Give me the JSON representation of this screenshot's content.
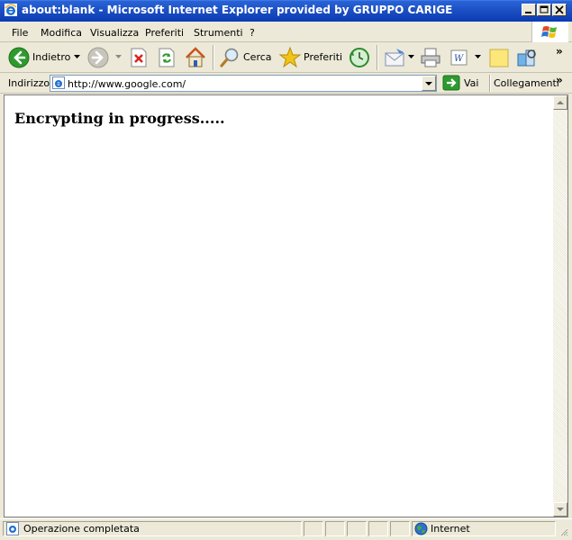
{
  "window": {
    "title": "about:blank - Microsoft Internet Explorer provided by GRUPPO CARIGE",
    "icon": "ie-icon",
    "controls": [
      "minimize-icon",
      "maximize-icon",
      "close-icon"
    ]
  },
  "menu": {
    "items": [
      "File",
      "Modifica",
      "Visualizza",
      "Preferiti",
      "Strumenti",
      "?"
    ]
  },
  "toolbar": {
    "back_label": "Indietro",
    "search_label": "Cerca",
    "favorites_label": "Preferiti",
    "overflow": "»"
  },
  "address": {
    "label": "Indirizzo",
    "value": "http://www.google.com/",
    "go_label": "Vai",
    "links_label": "Collegamenti",
    "overflow": "»"
  },
  "content": {
    "heading": "Encrypting in progress....."
  },
  "status": {
    "text": "Operazione completata",
    "zone": "Internet"
  },
  "colors": {
    "titlebar": "#0a3bb3",
    "chrome": "#ece9d8",
    "back_green": "#2e9a2e",
    "star_yellow": "#f2c417"
  }
}
